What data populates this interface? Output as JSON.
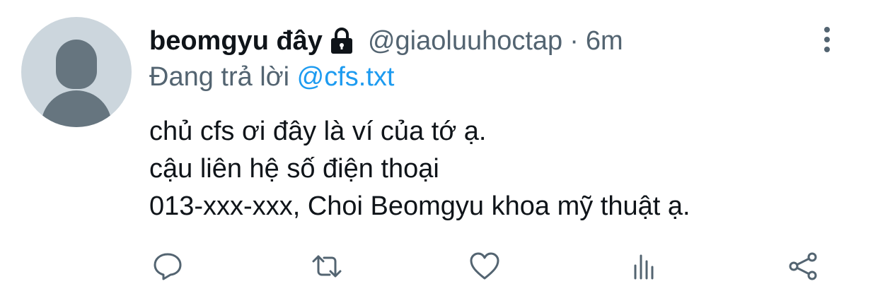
{
  "tweet": {
    "display_name": "beomgyu đây",
    "handle": "@giaoluuhoctap",
    "separator": "·",
    "time": "6m",
    "replying_prefix": "Đang trả lời",
    "replying_to": "@cfs.txt",
    "lines": [
      "chủ cfs ơi đây là ví của tớ ạ.",
      "cậu liên hệ số điện thoại",
      "013-xxx-xxx, Choi Beomgyu khoa mỹ thuật ạ."
    ]
  },
  "icons": {
    "avatar": "default-avatar",
    "lock": "lock-icon",
    "more": "more-vertical-icon",
    "reply": "reply-icon",
    "retweet": "retweet-icon",
    "like": "heart-icon",
    "analytics": "analytics-icon",
    "share": "share-icon"
  },
  "colors": {
    "text": "#0f1419",
    "secondary": "#536471",
    "link": "#1d9bf0",
    "avatar_bg": "#ccd6dd",
    "avatar_fg": "#66757f"
  }
}
